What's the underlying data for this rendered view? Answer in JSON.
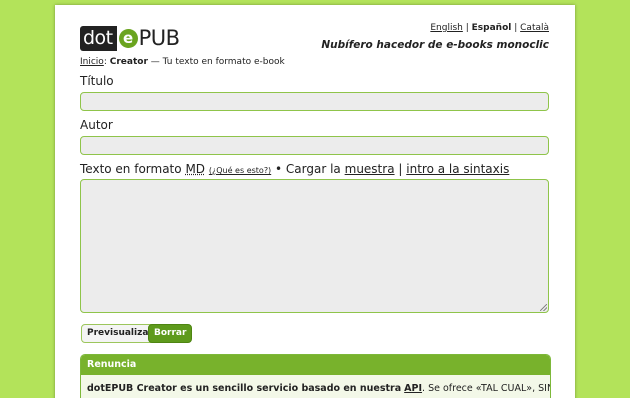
{
  "logo": {
    "part1": "dot",
    "part2": "e",
    "part3": "PUB"
  },
  "breadcrumb": {
    "home": "Inicio",
    "sep": ":",
    "current": "Creator",
    "rest": "— Tu texto en formato e-book"
  },
  "languages": [
    {
      "label": "English",
      "active": false
    },
    {
      "label": "Español",
      "active": true
    },
    {
      "label": "Català",
      "active": false
    }
  ],
  "lang_sep": "|",
  "tagline": "Nubífero hacedor de e-books monoclic",
  "form": {
    "title_label": "Título",
    "title_value": "",
    "author_label": "Autor",
    "author_value": "",
    "text_label_prefix": "Texto en formato",
    "md_link": "MD",
    "whats_this": "(¿Qué es esto?)",
    "bullet": "•",
    "load_prefix": "Cargar la",
    "sample_link": "muestra",
    "sep": "|",
    "syntax_link": "intro a la sintaxis",
    "text_value": ""
  },
  "buttons": {
    "preview": "Previsualizar",
    "clear": "Borrar"
  },
  "disclaimer": {
    "heading": "Renuncia",
    "text_bold": "dotEPUB Creator es un sencillo servicio basado en nuestra",
    "api_link": "API",
    "text_rest": ". Se ofrece «TAL CUAL», SIN"
  },
  "colors": {
    "background": "#b3e35a",
    "accent": "#78b22c",
    "button_dark": "#5e9a1c",
    "field_bg": "#ececec"
  }
}
